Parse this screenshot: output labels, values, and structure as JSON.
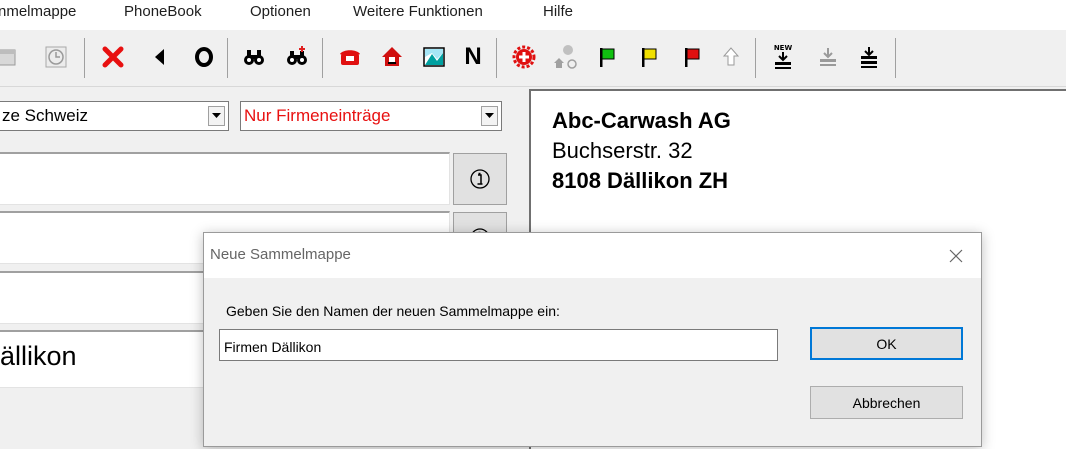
{
  "menu": {
    "items": [
      "nmelmappe",
      "PhoneBook",
      "Optionen",
      "Weitere Funktionen",
      "Hilfe"
    ]
  },
  "toolbar": {
    "buttons": [
      {
        "icon": "calendar-icon"
      },
      {
        "icon": "clock-icon"
      },
      {
        "icon": "delete-x-icon",
        "color": "#e81010"
      },
      {
        "icon": "back-arrow-icon"
      },
      {
        "icon": "letter-o-icon",
        "label": "O"
      },
      {
        "icon": "binoculars-icon"
      },
      {
        "icon": "binoculars-plus-icon"
      },
      {
        "icon": "telephone-icon",
        "color": "#e01010"
      },
      {
        "icon": "house-icon",
        "color": "#d01010"
      },
      {
        "icon": "map-icon"
      },
      {
        "icon": "letter-n-icon",
        "label": "N"
      },
      {
        "icon": "swiss-flag-gear-icon",
        "color": "#e01010"
      },
      {
        "icon": "house-network-icon"
      },
      {
        "icon": "green-flag-icon",
        "color": "#10c010"
      },
      {
        "icon": "yellow-flag-icon",
        "color": "#f0e000"
      },
      {
        "icon": "red-flag-icon",
        "color": "#e01010"
      },
      {
        "icon": "up-arrow-icon"
      },
      {
        "icon": "new-import-icon",
        "label": "NEW"
      },
      {
        "icon": "import-icon"
      },
      {
        "icon": "import-double-icon"
      }
    ]
  },
  "search": {
    "region_value": "ze Schweiz",
    "filter_value": "Nur Firmeneinträge",
    "filter_color": "#e81010",
    "field1_value": "",
    "field2_value": "",
    "field3_value": "",
    "city_value": "ällikon"
  },
  "address": {
    "name": "Abc-Carwash AG",
    "street": "Buchserstr. 32",
    "city": "8108 Dällikon ZH"
  },
  "dialog": {
    "title": "Neue Sammelmappe",
    "prompt": "Geben Sie den Namen der neuen Sammelmappe ein:",
    "input_value": "Firmen Dällikon",
    "ok_label": "OK",
    "cancel_label": "Abbrechen",
    "accent": "#0078d7"
  }
}
